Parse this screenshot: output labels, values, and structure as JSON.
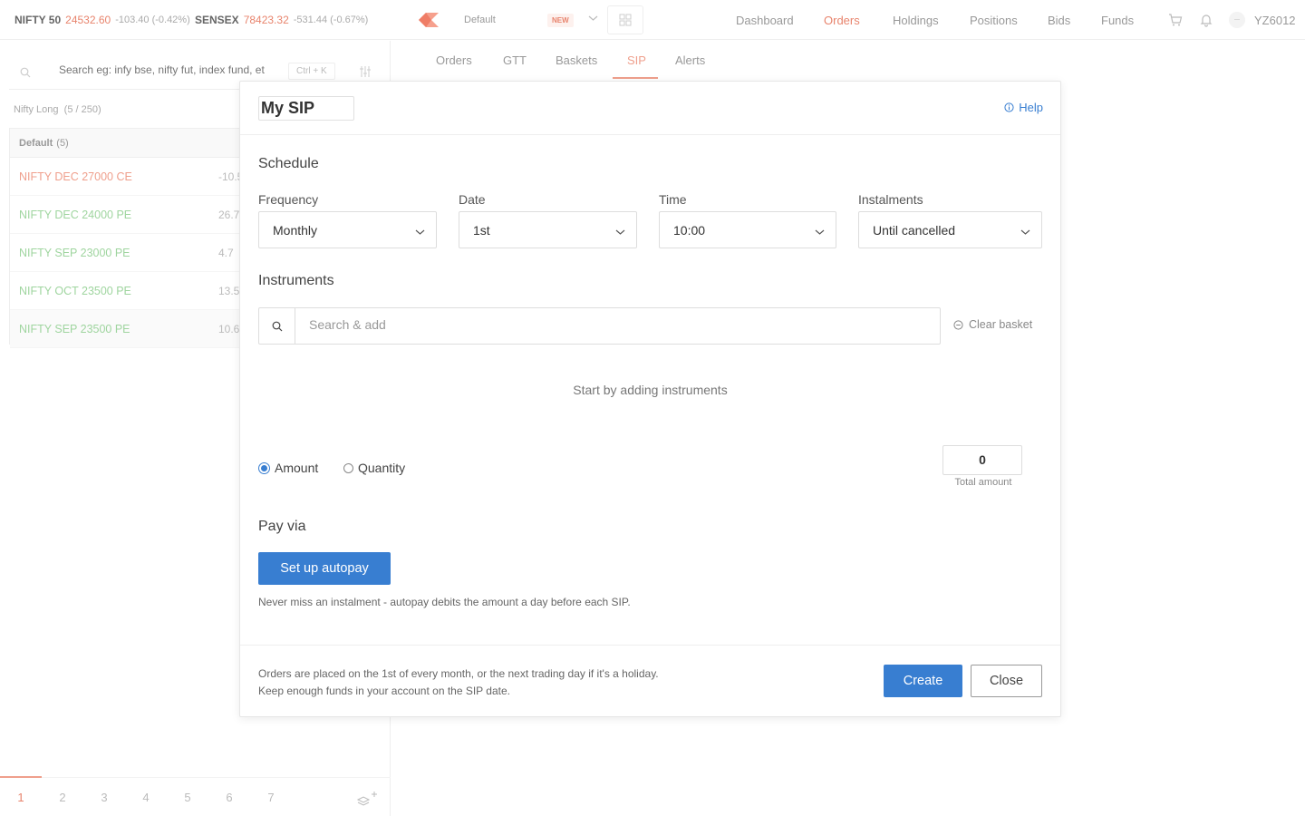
{
  "indices": [
    {
      "name": "NIFTY 50",
      "value": "24532.60",
      "change": "-103.40 (-0.42%)"
    },
    {
      "name": "SENSEX",
      "value": "78423.32",
      "change": "-531.44 (-0.67%)"
    }
  ],
  "marketwatch_selector": {
    "label": "Default",
    "badge": "NEW"
  },
  "nav": [
    "Dashboard",
    "Orders",
    "Holdings",
    "Positions",
    "Bids",
    "Funds"
  ],
  "nav_active": "Orders",
  "user": {
    "initials": "—",
    "id": "YZ6012"
  },
  "search": {
    "placeholder": "Search eg: infy bse, nifty fut, index fund, et",
    "shortcut": "Ctrl + K"
  },
  "watchlist": {
    "name": "Nifty Long",
    "count": "(5 / 250)",
    "group": "Default",
    "group_count": "(5)",
    "items": [
      {
        "symbol": "NIFTY DEC 27000 CE",
        "change": "-10.5",
        "trend": "red"
      },
      {
        "symbol": "NIFTY DEC 24000 PE",
        "change": "26.7",
        "trend": "green"
      },
      {
        "symbol": "NIFTY SEP 23000 PE",
        "change": "4.7",
        "trend": "green"
      },
      {
        "symbol": "NIFTY OCT 23500 PE",
        "change": "13.5",
        "trend": "green"
      },
      {
        "symbol": "NIFTY SEP 23500 PE",
        "change": "10.6",
        "trend": "green"
      }
    ]
  },
  "pages": [
    "1",
    "2",
    "3",
    "4",
    "5",
    "6",
    "7"
  ],
  "orders_tabs": [
    "Orders",
    "GTT",
    "Baskets",
    "SIP",
    "Alerts"
  ],
  "orders_tab_active": "SIP",
  "modal": {
    "sip_name": "My SIP",
    "help": "Help",
    "schedule_title": "Schedule",
    "frequency": {
      "label": "Frequency",
      "value": "Monthly"
    },
    "date": {
      "label": "Date",
      "value": "1st"
    },
    "time": {
      "label": "Time",
      "value": "10:00"
    },
    "instalments": {
      "label": "Instalments",
      "value": "Until cancelled"
    },
    "instruments_title": "Instruments",
    "instrument_search_placeholder": "Search & add",
    "clear_basket": "Clear basket",
    "empty_message": "Start by adding instruments",
    "mode_amount": "Amount",
    "mode_quantity": "Quantity",
    "total_value": "0",
    "total_label": "Total amount",
    "pay_via_title": "Pay via",
    "autopay_button": "Set up autopay",
    "autopay_note": "Never miss an instalment - autopay debits the amount a day before each SIP.",
    "footer_note_1": "Orders are placed on the 1st of every month, or the next trading day if it's a holiday.",
    "footer_note_2": "Keep enough funds in your account on the SIP date.",
    "create_button": "Create",
    "close_button": "Close"
  }
}
